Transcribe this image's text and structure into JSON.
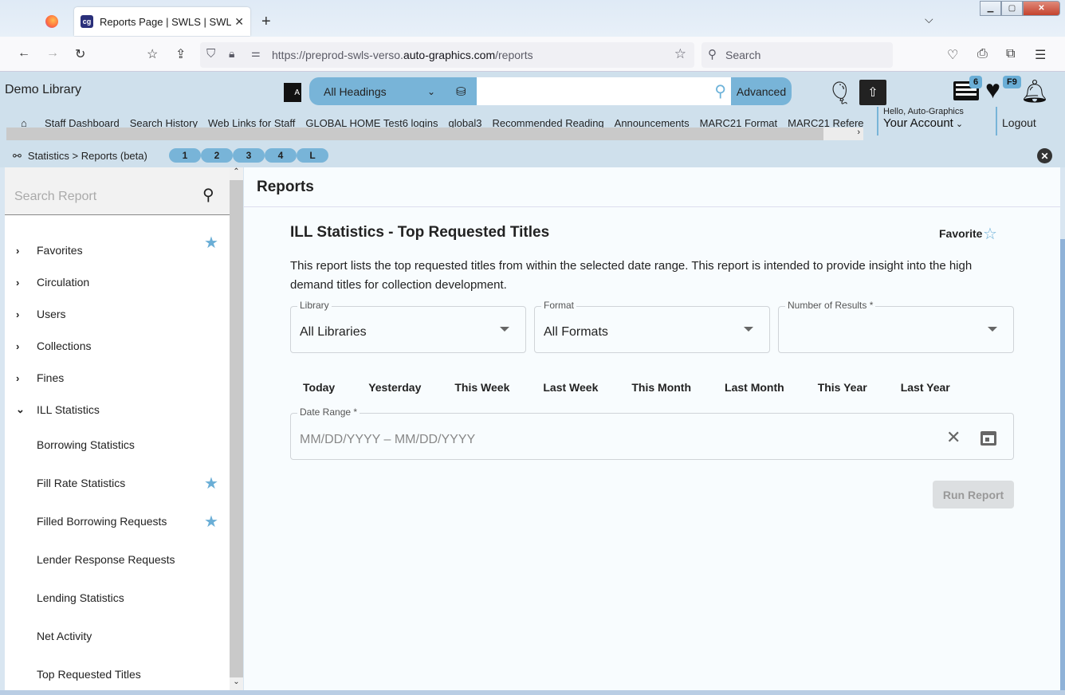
{
  "browser": {
    "tab_title": "Reports Page | SWLS | SWLS | Au",
    "tab_favicon": "ag-logo-icon",
    "url_prefix": "https://preprod-swls-verso.",
    "url_domain": "auto-graphics.com",
    "url_path": "/reports",
    "search_placeholder": "Search",
    "new_tab_label": "+",
    "list_tabs_label": "⌵"
  },
  "header": {
    "library_name": "Demo Library",
    "heading_select": "All Headings",
    "search_query": "",
    "advanced_label": "Advanced",
    "list_badge": "6",
    "favorites_badge": "F9",
    "hello": "Hello, Auto-Graphics",
    "account_label": "Your Account",
    "logout_label": "Logout",
    "links": [
      "Staff Dashboard",
      "Search History",
      "Web Links for Staff",
      "GLOBAL HOME Test6 logins",
      "global3",
      "Recommended Reading",
      "Announcements",
      "MARC21 Format",
      "MARC21 Refere"
    ]
  },
  "breadcrumb": {
    "text": "Statistics > Reports (beta)",
    "pills": [
      "1",
      "2",
      "3",
      "4",
      "L"
    ]
  },
  "sidebar": {
    "search_placeholder": "Search Report",
    "nodes": [
      {
        "label": "Favorites",
        "expanded": false,
        "starred": true
      },
      {
        "label": "Circulation",
        "expanded": false
      },
      {
        "label": "Users",
        "expanded": false
      },
      {
        "label": "Collections",
        "expanded": false
      },
      {
        "label": "Fines",
        "expanded": false
      },
      {
        "label": "ILL Statistics",
        "expanded": true
      }
    ],
    "leaves": [
      {
        "label": "Borrowing Statistics",
        "starred": false
      },
      {
        "label": "Fill Rate Statistics",
        "starred": true
      },
      {
        "label": "Filled Borrowing Requests",
        "starred": true
      },
      {
        "label": "Lender Response Requests",
        "starred": false
      },
      {
        "label": "Lending Statistics",
        "starred": false
      },
      {
        "label": "Net Activity",
        "starred": false
      },
      {
        "label": "Top Requested Titles",
        "starred": false
      }
    ]
  },
  "main": {
    "page_title": "Reports",
    "report_title": "ILL Statistics - Top Requested Titles",
    "favorite_label": "Favorite",
    "description": "This report lists the top requested titles from within the selected date range. This report is intended to provide insight into the high demand titles for collection development.",
    "fields": {
      "library": {
        "label": "Library",
        "value": "All Libraries"
      },
      "format": {
        "label": "Format",
        "value": "All Formats"
      },
      "num_results": {
        "label": "Number of Results *",
        "value": ""
      }
    },
    "quick_ranges": [
      "Today",
      "Yesterday",
      "This Week",
      "Last Week",
      "This Month",
      "Last Month",
      "This Year",
      "Last Year"
    ],
    "date_range": {
      "label": "Date Range *",
      "placeholder": "MM/DD/YYYY – MM/DD/YYYY"
    },
    "run_report_label": "Run Report"
  },
  "colors": {
    "accent": "#78b4d8",
    "header_bg": "#cfe0ec",
    "star": "#6aaed6"
  }
}
